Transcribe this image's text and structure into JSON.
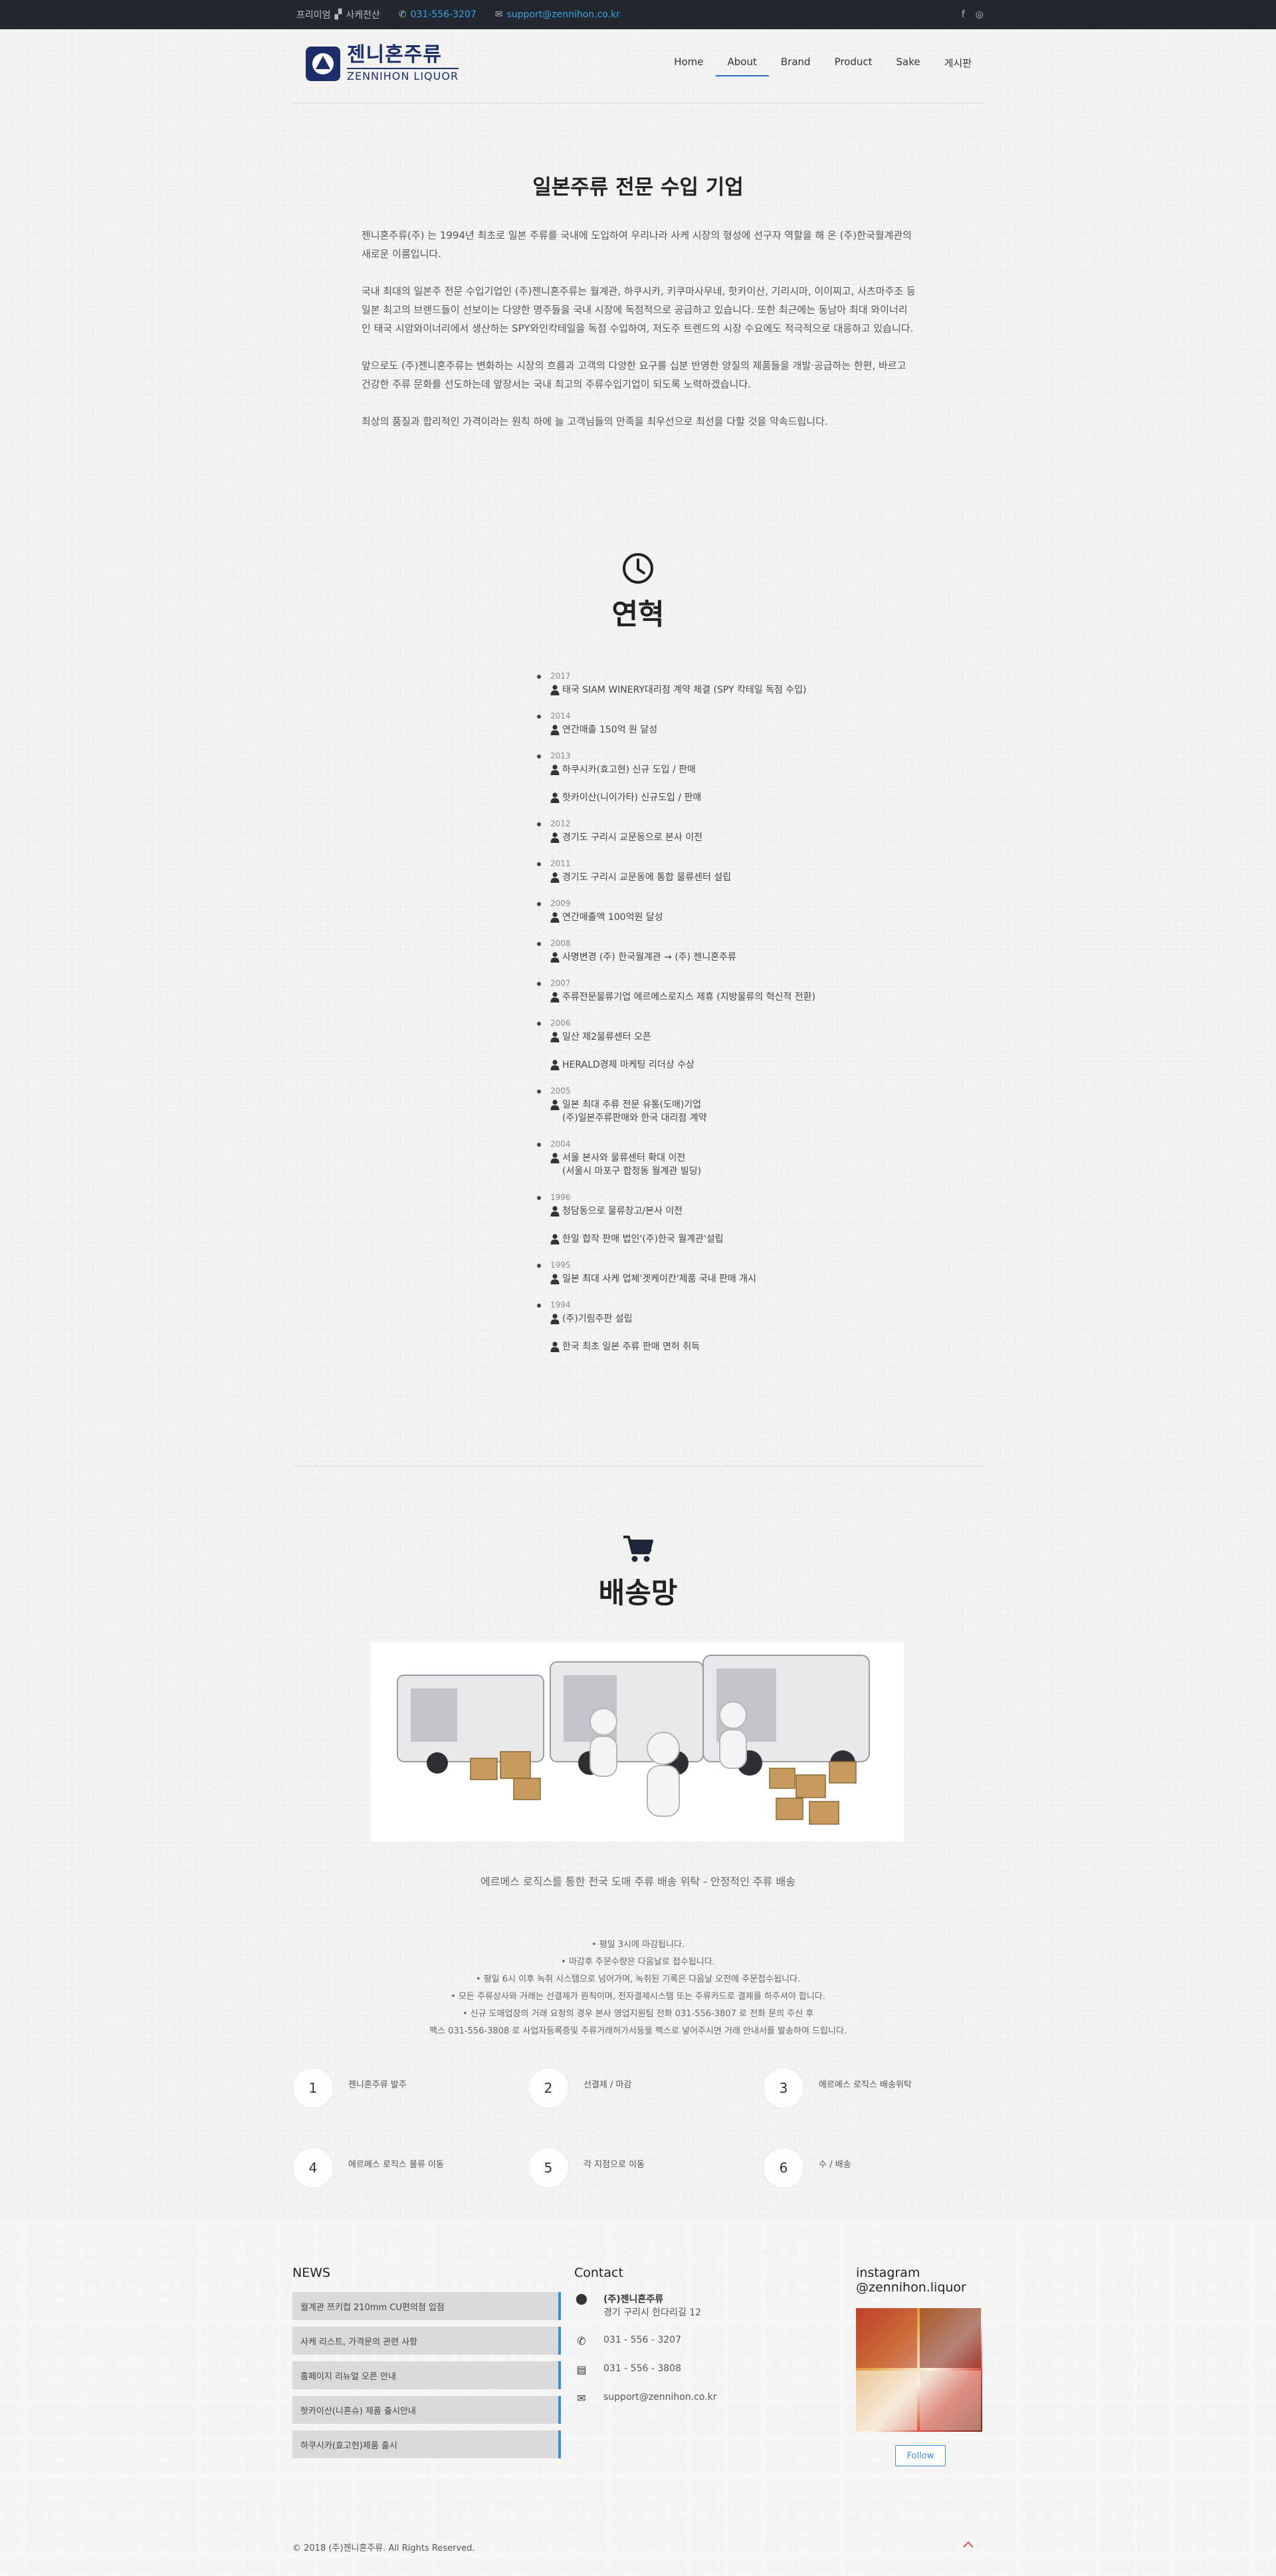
{
  "topbar": {
    "lang": "프리미엄",
    "notice": "사케전산",
    "phone": "031-556-3207",
    "email": "support@zennihon.co.kr",
    "social": [
      "facebook-icon",
      "instagram-icon"
    ]
  },
  "header": {
    "logo_ko": "젠니혼주류",
    "logo_en": "ZENNIHON LIQUOR",
    "nav": [
      "Home",
      "About",
      "Brand",
      "Product",
      "Sake",
      "게시판"
    ],
    "active_nav": "About"
  },
  "intro": {
    "title": "일본주류 전문 수입 기업",
    "paragraphs": [
      "젠니혼주류(주) 는 1994년 최초로 일본 주류를 국내에 도입하여 우리나라 사케 시장의 형성에 선구자 역할을 해 온 (주)한국월계관의 새로운 이름입니다.",
      "국내 최대의 일본주 전문 수입기업인 (주)젠니혼주류는 월계관, 하쿠시카, 키쿠마사무네, 핫카이산, 기리시마, 이이찌고, 사츠마주조 등 일본 최고의 브랜드들이 선보이는 다양한 명주들을 국내 시장에 독점적으로 공급하고 있습니다. 또한 최근에는 동남아 최대 와이너리인 태국 시암와이너리에서 생산하는 SPY와인칵테일을 독점 수입하여, 저도주 트렌드의 시장 수요에도 적극적으로 대응하고 있습니다.",
      "앞으로도 (주)젠니혼주류는 변화하는 시장의 흐름과 고객의 다양한 요구를 십분 반영한 양질의 제품들을 개발·공급하는 한편, 바르고 건강한 주류 문화를 선도하는데 앞장서는 국내 최고의 주류수입기업이 되도록 노력하겠습니다.",
      "최상의 품질과 합리적인 가격이라는 원칙 하에 늘 고객님들의 만족을 최우선으로 최선을 다할 것을 약속드립니다."
    ]
  },
  "history": {
    "title": "연혁",
    "icon": "clock-icon",
    "entries": [
      {
        "year": "2017",
        "events": [
          "태국 SIAM WINERY대리점 계약 체결 (SPY 칵테일 독점 수입)"
        ]
      },
      {
        "year": "2014",
        "events": [
          "연간매출 150억 원 달성"
        ]
      },
      {
        "year": "2013",
        "events": [
          "하쿠시카(효고현) 신규 도입 / 판매",
          "핫카이산(니이가타) 신규도입 / 판매"
        ]
      },
      {
        "year": "2012",
        "events": [
          "경기도 구리시 교문동으로 본사 이전"
        ]
      },
      {
        "year": "2011",
        "events": [
          "경기도 구리시 교문동에 통합 물류센터 설립"
        ]
      },
      {
        "year": "2009",
        "events": [
          "연간매출액 100억원 달성"
        ]
      },
      {
        "year": "2008",
        "events": [
          "사명변경 (주) 한국월계관 → (주) 젠니혼주류"
        ]
      },
      {
        "year": "2007",
        "events": [
          "주류전문물류기업 에르메스로지스 제휴 (지방물류의 혁신적 전환)"
        ]
      },
      {
        "year": "2006",
        "events": [
          "일산 제2물류센터 오픈",
          "HERALD경제 마케팅 리더상 수상"
        ]
      },
      {
        "year": "2005",
        "events": [
          "일본 최대 주류 전문 유통(도매)기업\n(주)일본주류판매와 한국 대리점 계약"
        ]
      },
      {
        "year": "2004",
        "events": [
          "서울 본사와 물류센터 확대 이전\n(서울시 마포구 합정동 월계관 빌딩)"
        ]
      },
      {
        "year": "1996",
        "events": [
          "청담동으로 물류창고/본사 이전",
          "한일 합작 판매 법인'(주)한국 월계관'설립"
        ]
      },
      {
        "year": "1995",
        "events": [
          "일본 최대 사케 업체'겟케이칸'제품 국내 판매 개시"
        ]
      },
      {
        "year": "1994",
        "events": [
          "(주)기림주판 설립",
          "한국 최초 일본 주류 판매 면허 취득"
        ]
      }
    ]
  },
  "delivery": {
    "title": "배송망",
    "icon": "shopping-cart-icon",
    "caption": "에르메스 로직스를 통한 전국 도매 주류 배송 위탁 - 안정적인 주류 배송",
    "notes": [
      "• 평일 3시에 마감됩니다.",
      "• 마감후 주문수량은 다음날로 접수됩니다.",
      "• 평일 6시 이후 녹취 시스템으로 넘어가며, 녹취된 기록은 다음날 오전에 주문접수됩니다.",
      "• 모든 주류상사와 거래는 선결제가 원칙이며, 전자결제시스템 또는 주류카드로 결제를 하주셔야 합니다.",
      "• 신규 도매업장의 거래 요청의 경우 본사 영업지원팀 전화 031-556-3807 로 전화 문의 주신 후",
      "팩스 031-556-3808 로 사업자등록증및 주류거래허가서등을 팩스로 넣어주시면 거래 안내서를 발송하여 드립니다."
    ],
    "steps": [
      {
        "num": "1",
        "label": "젠니혼주류 발주"
      },
      {
        "num": "2",
        "label": "선결제 / 마감"
      },
      {
        "num": "3",
        "label": "에르메스 로직스 배송위탁"
      },
      {
        "num": "4",
        "label": "에르메스 로직스 물류 이동"
      },
      {
        "num": "5",
        "label": "각 지점으로 이동"
      },
      {
        "num": "6",
        "label": "수 / 배송"
      }
    ]
  },
  "footer": {
    "news_title": "NEWS",
    "news": [
      "월계관 쯔키컵 210mm CU편의점 입점",
      "사케 리스트, 가격문의 관련 사항",
      "홈페이지 리뉴얼 오픈 안내",
      "핫카이산(니혼슈) 제품 출시안내",
      "하쿠시카(효고현)제품 출시"
    ],
    "contact_title": "Contact",
    "company": "(주)젠니혼주류",
    "address": "경기 구리시 한다리길 12",
    "tel": "031 - 556 - 3207",
    "fax": "031 - 556 - 3808",
    "email": "support@zennihon.co.kr",
    "instagram_title": "instagram",
    "instagram_handle": "@zennihon.liquor",
    "follow": "Follow",
    "copyright": "© 2018 (주)젠니혼주류. All Rights Reserved."
  }
}
